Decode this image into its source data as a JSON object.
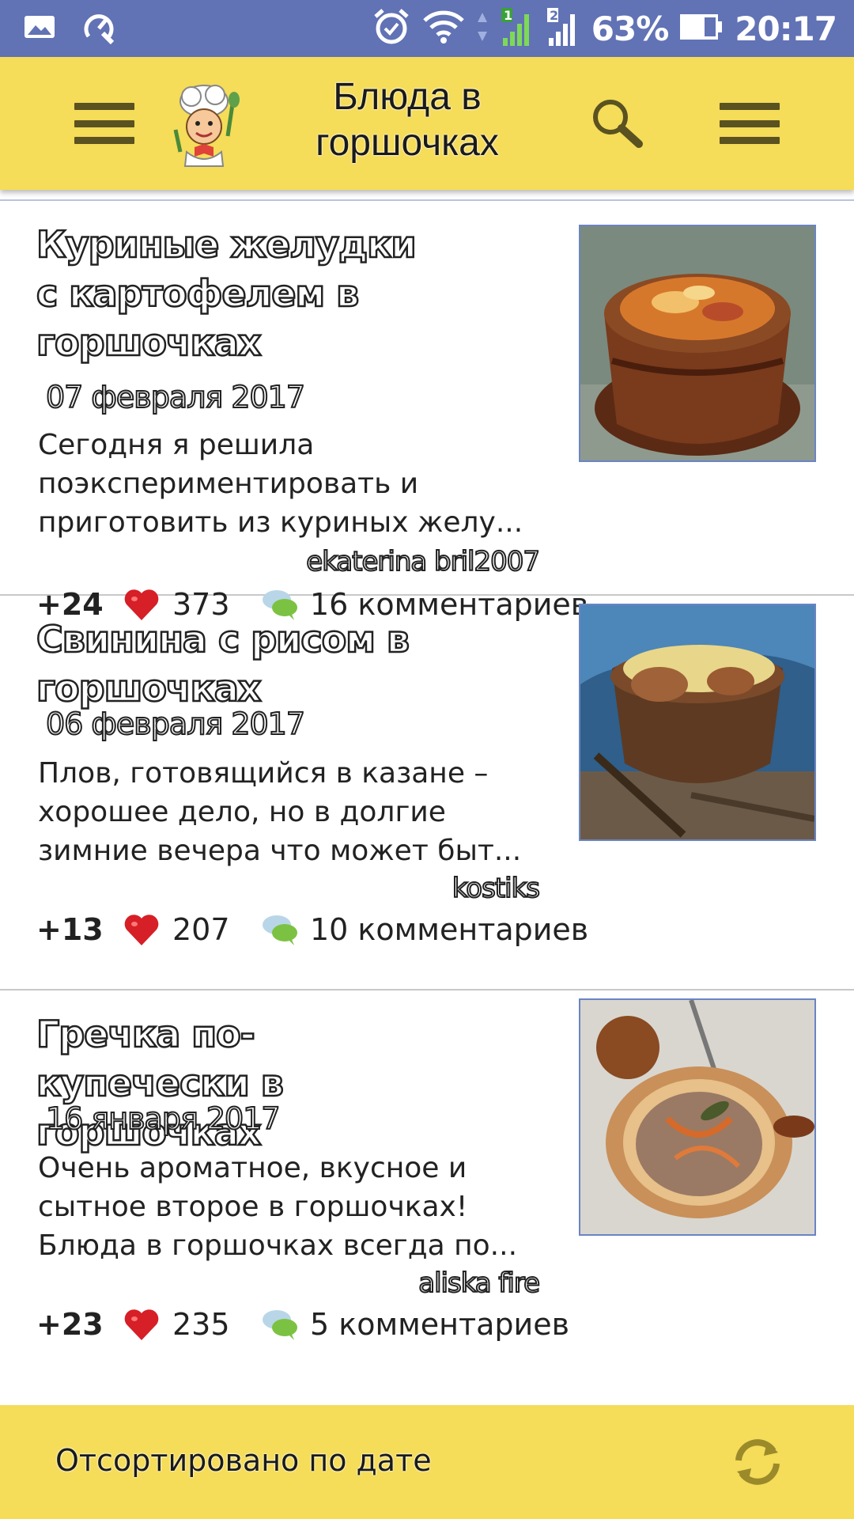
{
  "status_bar": {
    "battery": "63%",
    "time": "20:17",
    "sim1": "1",
    "sim2": "2"
  },
  "header": {
    "title": "Блюда в горшочках",
    "menu_icon": "hamburger-icon",
    "search_icon": "search-icon",
    "overflow_icon": "hamburger-icon"
  },
  "recipes": [
    {
      "title": "Куриные желудки с картофелем в горшочках",
      "date": "07 февраля 2017",
      "description": "Сегодня я решила поэкспериментировать и приготовить из куриных желу...",
      "author": "ekaterina bril2007",
      "score": "+24",
      "likes": "373",
      "comments": "16 комментариев"
    },
    {
      "title": "Свинина с рисом в горшочках",
      "date": "06 февраля 2017",
      "description": "Плов, готовящийся в казане – хорошее дело, но в долгие зимние вечера что может быт...",
      "author": "kostiks",
      "score": "+13",
      "likes": "207",
      "comments": "10 комментариев"
    },
    {
      "title": "Гречка по-купечески в горшочках",
      "date": "16 января 2017",
      "description": "Очень ароматное, вкусное и сытное второе в горшочках! Блюда в горшочках всегда по...",
      "author": "aliska fire",
      "score": "+23",
      "likes": "235",
      "comments": "5 комментариев"
    }
  ],
  "footer": {
    "sort_label": "Отсортировано по дате",
    "refresh_icon": "refresh-icon"
  },
  "colors": {
    "status_bar": "#6172b5",
    "app_bar": "#f5dc59",
    "thumb_border": "#6a84c4"
  }
}
